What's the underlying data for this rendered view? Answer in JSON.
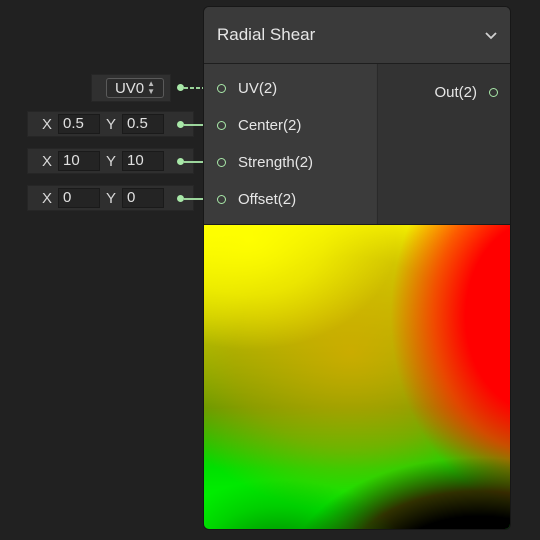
{
  "node": {
    "title": "Radial Shear",
    "inputs": [
      {
        "label": "UV(2)"
      },
      {
        "label": "Center(2)"
      },
      {
        "label": "Strength(2)"
      },
      {
        "label": "Offset(2)"
      }
    ],
    "output": {
      "label": "Out(2)"
    }
  },
  "controls": {
    "uv_channel": "UV0",
    "center": {
      "x_label": "X",
      "x": "0.5",
      "y_label": "Y",
      "y": "0.5"
    },
    "strength": {
      "x_label": "X",
      "x": "10",
      "y_label": "Y",
      "y": "10"
    },
    "offset": {
      "x_label": "X",
      "x": "0",
      "y_label": "Y",
      "y": "0"
    }
  },
  "colors": {
    "port_green": "#a8e8a8",
    "node_bg": "#393939",
    "canvas_bg": "#212121"
  },
  "icons": {
    "collapse": "chevron-down-icon",
    "select_arrows": "updown-arrows-icon"
  }
}
